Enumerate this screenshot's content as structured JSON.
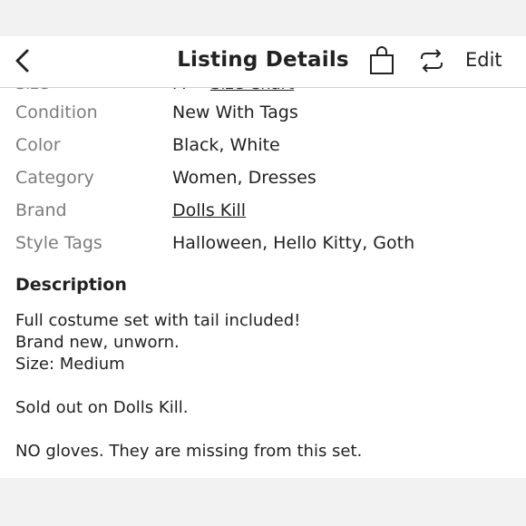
{
  "header": {
    "title": "Listing Details",
    "edit_label": "Edit"
  },
  "partial_row": {
    "label": "Size",
    "value": "M",
    "link": "Size Chart"
  },
  "details": [
    {
      "label": "Condition",
      "value": "New With Tags",
      "link": false
    },
    {
      "label": "Color",
      "value": "Black, White",
      "link": false
    },
    {
      "label": "Category",
      "value": "Women, Dresses",
      "link": false
    },
    {
      "label": "Brand",
      "value": "Dolls Kill",
      "link": true
    },
    {
      "label": "Style Tags",
      "value": "Halloween, Hello Kitty, Goth",
      "link": false
    }
  ],
  "description": {
    "heading": "Description",
    "lines": [
      "Full costume set with tail included!",
      "Brand new, unworn.",
      "Size: Medium",
      "",
      "Sold out on Dolls Kill.",
      "",
      "NO gloves. They are missing from this set."
    ]
  },
  "icons": {
    "back": "chevron-left-icon",
    "bag": "shopping-bag-icon",
    "share": "repost-arrows-icon"
  }
}
